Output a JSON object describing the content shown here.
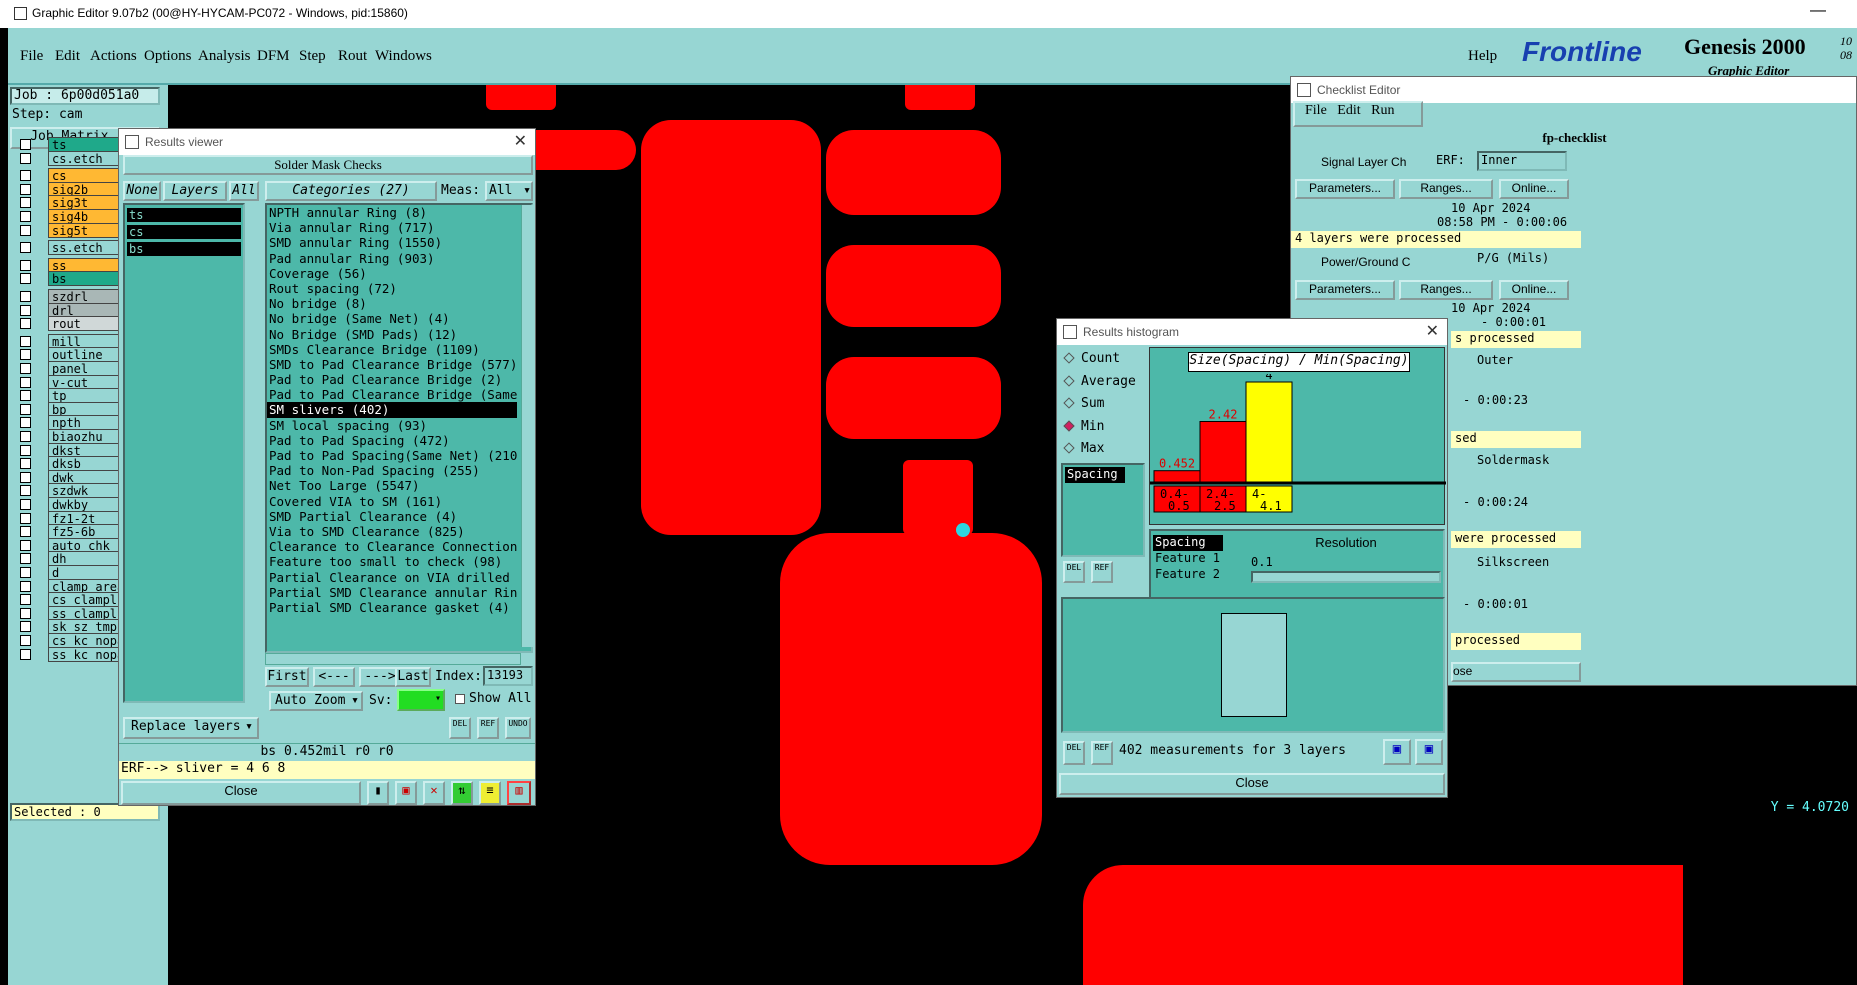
{
  "window_title": "Graphic Editor 9.07b2 (00@HY-HYCAM-PC072 - Windows, pid:15860)",
  "menu": [
    "File",
    "Edit",
    "Actions",
    "Options",
    "Analysis",
    "DFM",
    "Step",
    "Rout",
    "Windows"
  ],
  "help": "Help",
  "logo": {
    "brand": "Frontline",
    "product": "Genesis 2000",
    "sub": "Graphic Editor",
    "corner1": "10",
    "corner2": "08"
  },
  "job": {
    "job": "Job : 6p00d051a0",
    "step": "Step: cam",
    "matrix": "Job Matrix ...",
    "selected": "Selected : 0"
  },
  "layers": [
    {
      "n": "ts",
      "c": "#1fa98a"
    },
    {
      "n": "cs.etch",
      "c": "#97d6d3"
    },
    {
      "n": "cs",
      "c": "#ffb833"
    },
    {
      "n": "sig2b",
      "c": "#ffb833"
    },
    {
      "n": "sig3t",
      "c": "#ffb833"
    },
    {
      "n": "sig4b",
      "c": "#ffb833"
    },
    {
      "n": "sig5t",
      "c": "#ffb833"
    },
    {
      "n": "ss.etch",
      "c": "#97d6d3"
    },
    {
      "n": "ss",
      "c": "#ffb833"
    },
    {
      "n": "bs",
      "c": "#1fa98a"
    },
    {
      "n": "szdrl",
      "c": "#a9b7b6"
    },
    {
      "n": "drl",
      "c": "#a9b7b6"
    },
    {
      "n": "rout",
      "c": "#d0d8d8"
    },
    {
      "n": "mill",
      "c": "#97d6d3"
    },
    {
      "n": "outline",
      "c": "#97d6d3"
    },
    {
      "n": "panel",
      "c": "#97d6d3"
    },
    {
      "n": "v-cut",
      "c": "#97d6d3"
    },
    {
      "n": "tp",
      "c": "#97d6d3"
    },
    {
      "n": "bp",
      "c": "#97d6d3"
    },
    {
      "n": "npth",
      "c": "#97d6d3"
    },
    {
      "n": "biaozhu",
      "c": "#97d6d3"
    },
    {
      "n": "dkst",
      "c": "#97d6d3"
    },
    {
      "n": "dksb",
      "c": "#97d6d3"
    },
    {
      "n": "dwk",
      "c": "#97d6d3"
    },
    {
      "n": "szdwk",
      "c": "#97d6d3"
    },
    {
      "n": "dwkby",
      "c": "#97d6d3"
    },
    {
      "n": "fz1-2t",
      "c": "#97d6d3"
    },
    {
      "n": "fz5-6b",
      "c": "#97d6d3"
    },
    {
      "n": "auto_chk_pn",
      "c": "#97d6d3"
    },
    {
      "n": "dh",
      "c": "#97d6d3"
    },
    {
      "n": "d",
      "c": "#97d6d3"
    },
    {
      "n": "clamp_area",
      "c": "#97d6d3"
    },
    {
      "n": "cs_clampline",
      "c": "#97d6d3"
    },
    {
      "n": "ss_clampline",
      "c": "#97d6d3"
    },
    {
      "n": "sk_sz_tmp",
      "c": "#97d6d3"
    },
    {
      "n": "cs_kc_nopad",
      "c": "#97d6d3"
    },
    {
      "n": "ss_kc_nopad",
      "c": "#97d6d3"
    }
  ],
  "results_viewer": {
    "title": "Results viewer",
    "header": "Solder Mask Checks",
    "none": "None",
    "layers": "Layers",
    "all": "All",
    "categories_label": "Categories (27)",
    "meas": "Meas:",
    "meas_val": "All",
    "layer_items": [
      "ts",
      "cs",
      "bs"
    ],
    "categories": [
      "NPTH annular Ring (8)",
      "Via annular Ring (717)",
      "SMD annular Ring (1550)",
      "Pad annular Ring (903)",
      "Coverage (56)",
      "Rout spacing (72)",
      "No bridge (8)",
      "No bridge (Same Net) (4)",
      "No Bridge (SMD Pads) (12)",
      "SMDs Clearance Bridge (1109)",
      "SMD to Pad Clearance Bridge (577)",
      "Pad to Pad Clearance Bridge (2)",
      "Pad to Pad Clearance Bridge (Same",
      "SM slivers (402)",
      "SM local spacing (93)",
      "Pad to Pad Spacing (472)",
      "Pad to Pad Spacing(Same Net) (210",
      "Pad to Non-Pad Spacing (255)",
      "Net Too Large (5547)",
      "Covered VIA to SM (161)",
      "SMD Partial Clearance (4)",
      "Via to SMD Clearance (825)",
      "Clearance to Clearance Connection",
      "Feature too small to check (98)",
      "Partial Clearance on VIA drilled",
      "Partial SMD Clearance annular Rin",
      "Partial SMD Clearance gasket (4)"
    ],
    "selected_index": 13,
    "first": "First",
    "prev": "<---",
    "next": "--->",
    "last": "Last",
    "index_label": "Index:",
    "index_val": "13193",
    "auto_zoom": "Auto Zoom",
    "sv": "Sv:",
    "show_all": "Show All",
    "replace": "Replace layers",
    "del": "DEL",
    "ref": "REF",
    "undo": "UNDO",
    "status": "bs 0.452mil  r0  r0",
    "erf": "ERF--> sliver = 4 6 8",
    "close": "Close"
  },
  "histogram": {
    "title": "Results histogram",
    "options": [
      "Count",
      "Average",
      "Sum",
      "Min",
      "Max"
    ],
    "selected": "Min",
    "measure": "Spacing",
    "chart_title": "Size(Spacing) / Min(Spacing)",
    "values": [
      "0.452",
      "2.42",
      "4"
    ],
    "bins": [
      "0.4-\n0.5",
      "2.4-\n2.5",
      "4-\n4.1"
    ],
    "list": [
      "Spacing",
      "Feature 1",
      "Feature 2"
    ],
    "resolution": "Resolution",
    "res_val": "0.1",
    "footer": "402 measurements for 3 layers",
    "close": "Close",
    "del": "DEL",
    "ref": "REF"
  },
  "checklist": {
    "title": "Checklist Editor",
    "menu": [
      "File",
      "Edit",
      "Run"
    ],
    "name": "fp-checklist",
    "signal": "Signal Layer Ch",
    "erf": "ERF:",
    "inner": "Inner",
    "params": "Parameters...",
    "ranges": "Ranges...",
    "online": "Online...",
    "date1": "10 Apr 2024",
    "time1": "08:58 PM - 0:00:06",
    "msg1": "4 layers were processed",
    "power": "Power/Ground C",
    "pg": "P/G (Mils)",
    "date2": "10 Apr 2024",
    "time2": "- 0:00:01",
    "msg2": "s processed",
    "outer": "Outer",
    "f": "F:",
    "s": "s...",
    "year": "2024",
    "t3": "- 0:00:23",
    "msg3": "sed",
    "solder": "Soldermask",
    "t4": "- 0:00:24",
    "msg4": "were processed",
    "silk": "Silkscreen",
    "t5": "- 0:00:01",
    "msg5": "processed",
    "close": "ose"
  },
  "coord": "Y = 4.0720"
}
